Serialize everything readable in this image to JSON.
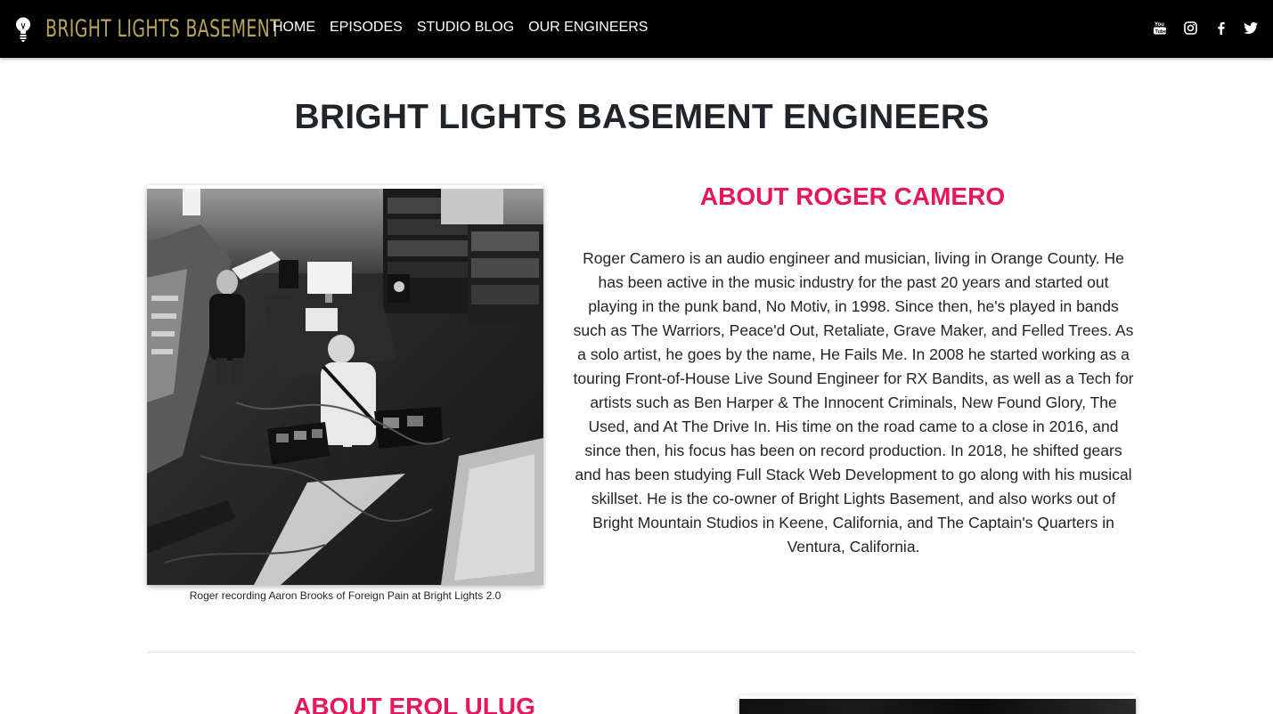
{
  "brand": {
    "name": "BRIGHT LIGHTS BASEMENT",
    "logo_icon": "lightbulb-icon",
    "color": "#b5a45a"
  },
  "nav": {
    "items": [
      {
        "label": "HOME"
      },
      {
        "label": "EPISODES"
      },
      {
        "label": "STUDIO BLOG"
      },
      {
        "label": "OUR ENGINEERS"
      }
    ]
  },
  "social": [
    {
      "icon": "youtube-icon"
    },
    {
      "icon": "instagram-icon"
    },
    {
      "icon": "facebook-icon"
    },
    {
      "icon": "twitter-icon"
    }
  ],
  "page": {
    "title": "BRIGHT LIGHTS BASEMENT ENGINEERS"
  },
  "engineers": [
    {
      "heading": "ABOUT ROGER CAMERO",
      "photo_caption": "Roger recording Aaron Brooks of Foreign Pain at Bright Lights 2.0",
      "bio": "Roger Camero is an audio engineer and musician, living in Orange County. He has been active in the music industry for the past 20 years and started out playing in the punk band, No Motiv, in 1998. Since then, he's played in bands such as The Warriors, Peace'd Out, Retaliate, Grave Maker, and Felled Trees. As a solo artist, he goes by the name, He Fails Me. In 2008 he started working as a touring Front-of-House Live Sound Engineer for RX Bandits, as well as a Tech for artists such as Ben Harper & The Innocent Criminals, New Found Glory, The Used, and At The Drive In. His time on the road came to a close in 2016, and since then, his focus has been on record production. In 2018, he shifted gears and has been studying Full Stack Web Development to go along with his musical skillset. He is the co-owner of Bright Lights Basement, and also works out of Bright Mountain Studios in Keene, California, and The Captain's Quarters in Ventura, California."
    },
    {
      "heading": "ABOUT EROL ULUG"
    }
  ],
  "colors": {
    "accent": "#e8155f",
    "navbar": "#000000"
  }
}
